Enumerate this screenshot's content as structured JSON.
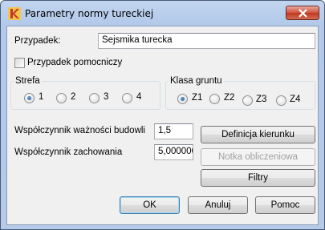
{
  "window": {
    "title": "Parametry normy tureckiej"
  },
  "case": {
    "label": "Przypadek:",
    "value": "Sejsmika turecka"
  },
  "auxiliary_case": {
    "label": "Przypadek pomocniczy",
    "checked": false
  },
  "zone": {
    "title": "Strefa",
    "options": [
      "1",
      "2",
      "3",
      "4"
    ],
    "selected": "1"
  },
  "soil_class": {
    "title": "Klasa gruntu",
    "options": [
      "Z1",
      "Z2",
      "Z3",
      "Z4"
    ],
    "selected": "Z1"
  },
  "importance_factor": {
    "label": "Współczynnik ważności budowli",
    "value": "1,5"
  },
  "behavior_factor": {
    "label": "Współczynnik zachowania",
    "value": "5,000000"
  },
  "buttons": {
    "direction_definition": "Definicja kierunku",
    "calculation_note": "Notka obliczeniowa",
    "filters": "Filtry",
    "ok": "OK",
    "cancel": "Anuluj",
    "help": "Pomoc"
  }
}
